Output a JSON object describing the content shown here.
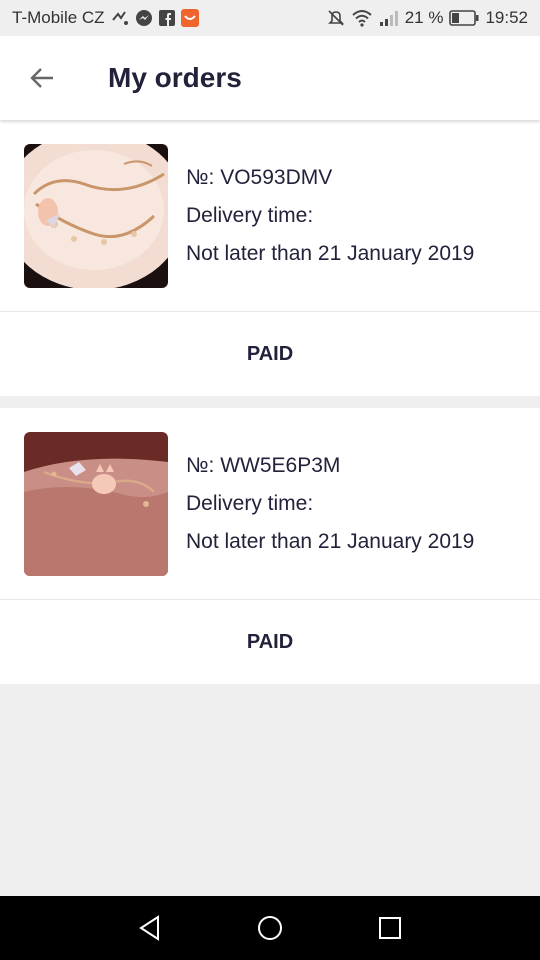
{
  "status_bar": {
    "carrier": "T-Mobile CZ",
    "battery": "21 %",
    "time": "19:52",
    "left_icons": [
      "missed-call-icon",
      "messenger-icon",
      "facebook-icon",
      "aliexpress-icon"
    ],
    "right_icons": [
      "mute-icon",
      "wifi-icon",
      "signal-icon",
      "battery-icon"
    ]
  },
  "app_bar": {
    "title": "My orders",
    "back_icon": "arrow-left-icon"
  },
  "orders": [
    {
      "number": "№: VO593DMV",
      "delivery_label": "Delivery time:",
      "delivery_value": "Not later than 21 January 2019",
      "status": "PAID",
      "image": "bracelet-on-plate"
    },
    {
      "number": "№: WW5E6P3M",
      "delivery_label": "Delivery time:",
      "delivery_value": "Not later than 21 January 2019",
      "status": "PAID",
      "image": "bracelet-on-wrist"
    }
  ],
  "nav_bar": {
    "buttons": [
      "back-triangle-icon",
      "home-circle-icon",
      "recents-square-icon"
    ]
  },
  "colors": {
    "background": "#efefef",
    "card": "#ffffff",
    "title_text": "#22223a",
    "nav_bar": "#000000"
  }
}
